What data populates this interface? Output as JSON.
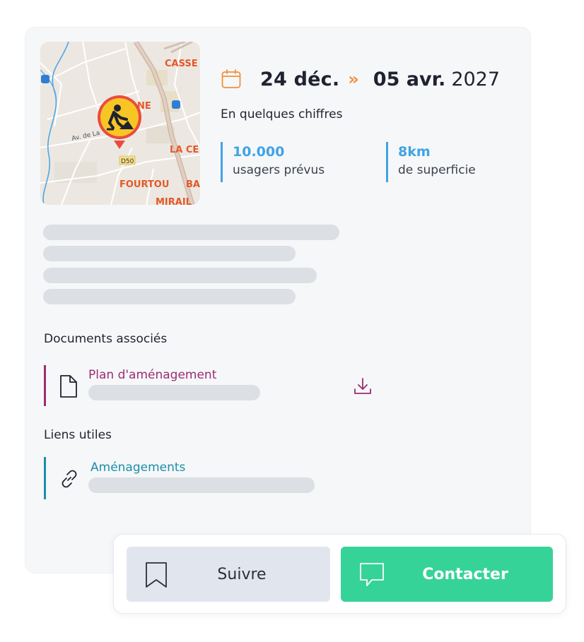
{
  "map": {
    "labels": [
      "CASSE",
      "Av. de La",
      "LA CE",
      "FOURTOU",
      "D50",
      "BA",
      "MIRAIL",
      "NE"
    ],
    "marker_icon": "roadwork-icon"
  },
  "dates": {
    "start": "24 déc.",
    "separator": "»",
    "end": "05 avr.",
    "year": "2027"
  },
  "figures": {
    "title": "En quelques chiffres",
    "items": [
      {
        "value": "10.000",
        "label": "usagers prévus"
      },
      {
        "value": "8km",
        "label": "de superficie"
      }
    ]
  },
  "documents": {
    "title": "Documents associés",
    "items": [
      {
        "label": "Plan d'aménagement"
      }
    ]
  },
  "links": {
    "title": "Liens utiles",
    "items": [
      {
        "label": "Aménagements"
      }
    ]
  },
  "actions": {
    "follow_label": "Suivre",
    "contact_label": "Contacter"
  },
  "colors": {
    "accent_orange": "#f0923a",
    "stat_blue": "#3fa3e5",
    "document_purple": "#9b2c72",
    "link_teal": "#1b8ea8",
    "contact_green": "#36d398"
  }
}
